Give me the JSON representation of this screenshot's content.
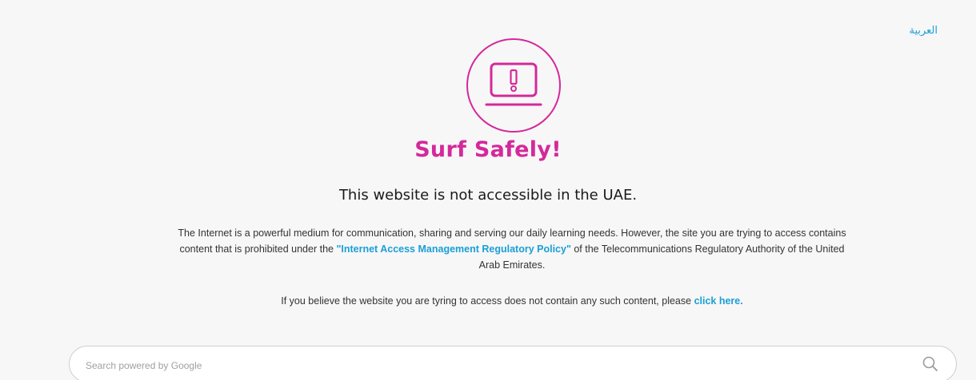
{
  "header": {
    "language_link": "العربية"
  },
  "hero": {
    "headline": "Surf Safely!",
    "subheadline": "This website is not accessible in the UAE."
  },
  "message": {
    "part1": "The Internet is a powerful medium for communication, sharing and serving our daily learning needs. However, the site you are trying to access contains content that is prohibited under the ",
    "policy_link": "\"Internet Access Management Regulatory Policy\"",
    "part2": " of the Telecommunications Regulatory Authority of the United Arab Emirates."
  },
  "appeal": {
    "text": "If you believe the website you are tyring to access does not contain any such content, please ",
    "link": "click here."
  },
  "search": {
    "placeholder": "Search powered by Google",
    "value": ""
  },
  "colors": {
    "accent": "#d4299a",
    "link": "#1a9fd6",
    "background": "#f7f7f7"
  },
  "icons": {
    "hero": "laptop-warning-icon",
    "search": "search-icon"
  }
}
